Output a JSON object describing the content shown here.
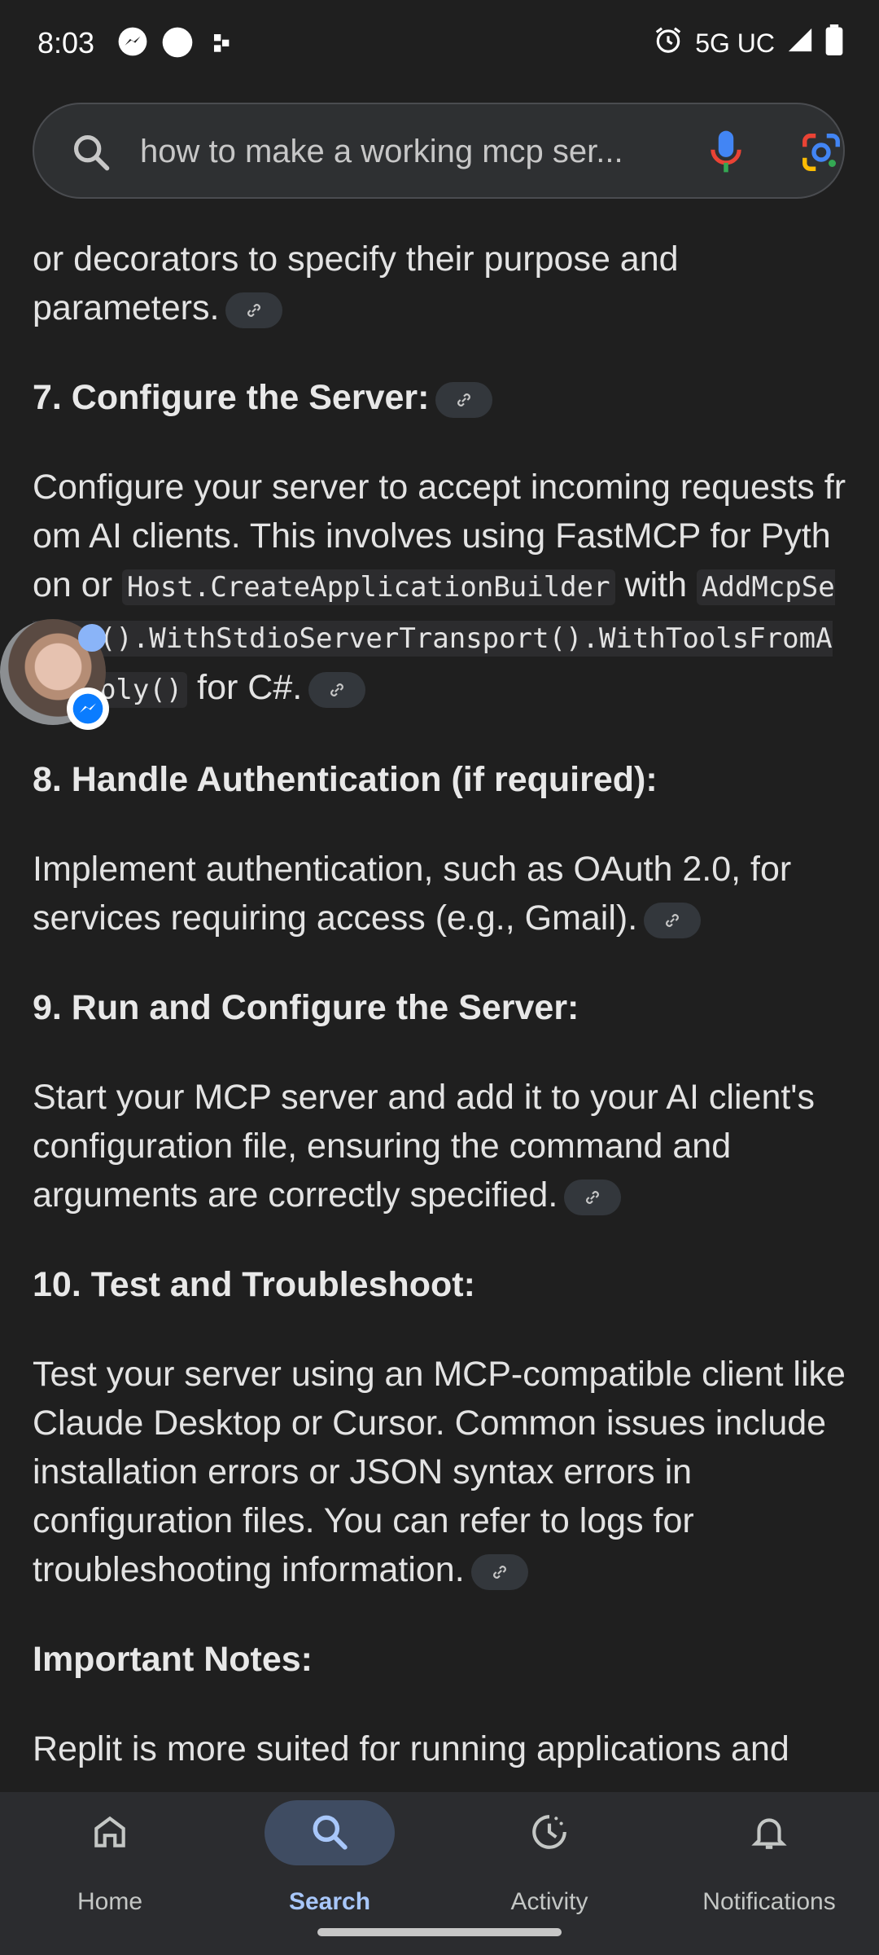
{
  "status_bar": {
    "time": "8:03",
    "network": "5G UC",
    "icons": [
      "messenger-icon",
      "circle-notification-icon",
      "app-notification-icon",
      "alarm-icon",
      "signal-icon",
      "battery-icon"
    ]
  },
  "search": {
    "query": "how to make a working mcp ser...",
    "icons": [
      "search-icon",
      "mic-icon",
      "google-lens-icon"
    ]
  },
  "content": {
    "intro_tail": "or decorators to specify their purpose and parameters.",
    "step7": {
      "heading": "7. Configure the Server:",
      "text1": "Configure your server to accept incoming requests from AI clients. This involves using FastMCP for Python or ",
      "code1": "Host.CreateApplicationBuilder",
      "text2": " with ",
      "code2": "AddMcpServer().WithStdioServerTransport().WithToolsFromAssembly()",
      "text3": " for C#."
    },
    "step8": {
      "heading": "8. Handle Authentication (if required):",
      "text": "Implement authentication, such as OAuth 2.0, for services requiring access (e.g., Gmail)."
    },
    "step9": {
      "heading": "9. Run and Configure the Server:",
      "text": "Start your MCP server and add it to your AI client's configuration file, ensuring the command and arguments are correctly specified."
    },
    "step10": {
      "heading": "10. Test and Troubleshoot:",
      "text": "Test your server using an MCP-compatible client like Claude Desktop or Cursor. Common issues include installation errors or JSON syntax errors in configuration files. You can refer to logs for troubleshooting information."
    },
    "notes": {
      "heading": "Important Notes:",
      "text": "Replit is more suited for running applications and"
    }
  },
  "nav": {
    "items": [
      {
        "label": "Home",
        "icon": "home-icon"
      },
      {
        "label": "Search",
        "icon": "search-icon",
        "active": true
      },
      {
        "label": "Activity",
        "icon": "activity-icon"
      },
      {
        "label": "Notifications",
        "icon": "bell-icon"
      }
    ]
  },
  "colors": {
    "background": "#1f1f1f",
    "accent": "#a8c7fa",
    "active_pill": "#3f4c62"
  }
}
